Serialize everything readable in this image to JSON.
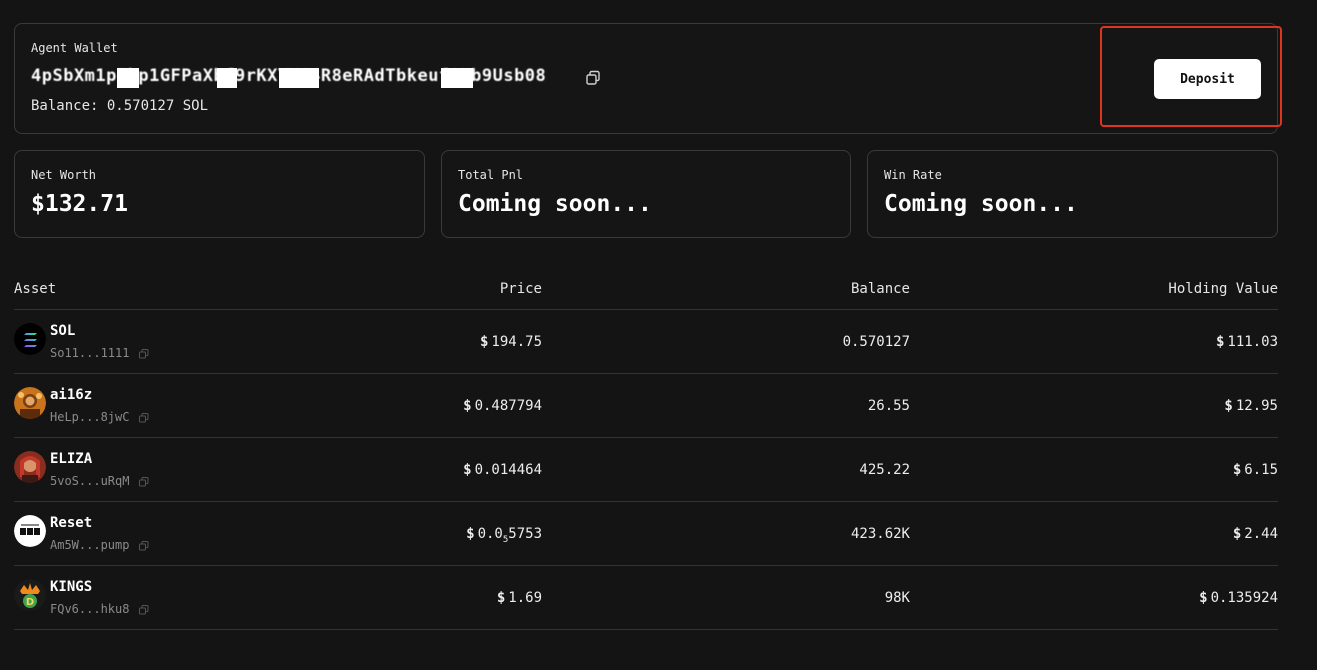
{
  "wallet": {
    "label": "Agent Wallet",
    "address": "4pSbXm1pEkp1GFPaXbf9rKXYXC4R8eRAdTbkeuf1Hb9Usb08",
    "balance_text": "Balance: 0.570127 SOL",
    "deposit_label": "Deposit"
  },
  "stats": {
    "net_worth": {
      "label": "Net Worth",
      "currency": "$",
      "value": "132.71"
    },
    "total_pnl": {
      "label": "Total Pnl",
      "value": "Coming soon..."
    },
    "win_rate": {
      "label": "Win Rate",
      "value": "Coming soon..."
    }
  },
  "table": {
    "headers": {
      "asset": "Asset",
      "price": "Price",
      "balance": "Balance",
      "holding_value": "Holding Value"
    },
    "currency_symbol": "$",
    "rows": [
      {
        "symbol": "SOL",
        "address": "So11...1111",
        "price": "194.75",
        "balance": "0.570127",
        "holding_value": "111.03",
        "icon": "solana-logo-icon"
      },
      {
        "symbol": "ai16z",
        "address": "HeLp...8jwC",
        "price": "0.487794",
        "balance": "26.55",
        "holding_value": "12.95",
        "icon": "ai16z-avatar-icon"
      },
      {
        "symbol": "ELIZA",
        "address": "5voS...uRqM",
        "price": "0.014464",
        "balance": "425.22",
        "holding_value": "6.15",
        "icon": "eliza-avatar-icon"
      },
      {
        "symbol": "Reset",
        "address": "Am5W...pump",
        "price_prefix": "0.0",
        "price_sub": "5",
        "price_suffix": "5753",
        "balance": "423.62K",
        "holding_value": "2.44",
        "icon": "reset-logo-icon"
      },
      {
        "symbol": "KINGS",
        "address": "FQv6...hku8",
        "price": "1.69",
        "balance": "98K",
        "holding_value": "0.135924",
        "icon": "kings-logo-icon"
      }
    ]
  },
  "colors": {
    "background": "#141414",
    "card_border": "#3a3a3a",
    "highlight_box": "#e0341d",
    "deposit_bg": "#ffffff",
    "muted_text": "#8a8a8a"
  }
}
